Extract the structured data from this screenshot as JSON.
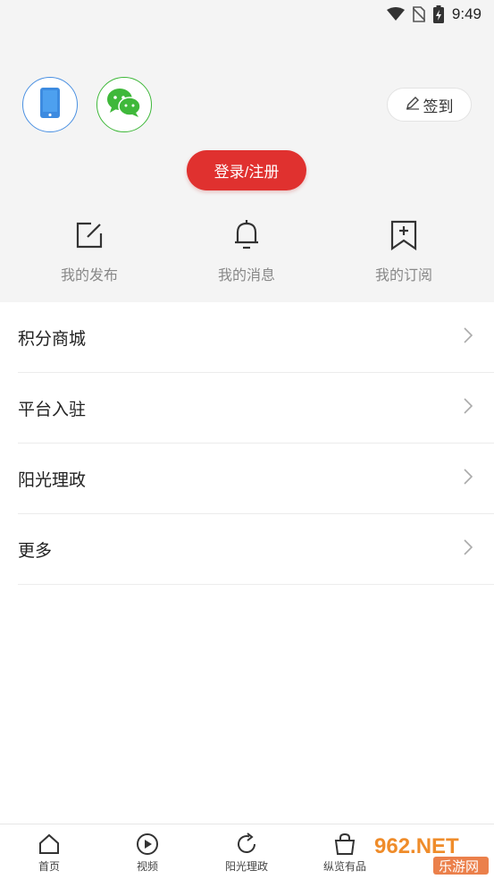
{
  "status_bar": {
    "time": "9:49",
    "icons": [
      "wifi-icon",
      "no-sim-icon",
      "battery-charging-icon"
    ]
  },
  "header": {
    "login_options": [
      {
        "name": "phone-login",
        "icon": "phone-icon",
        "color": "#4a90e2"
      },
      {
        "name": "wechat-login",
        "icon": "wechat-icon",
        "color": "#3fb83a"
      }
    ],
    "checkin_label": "签到",
    "login_register_label": "登录/注册",
    "accent_color": "#e0312f"
  },
  "quick_actions": [
    {
      "label": "我的发布",
      "icon": "edit-icon"
    },
    {
      "label": "我的消息",
      "icon": "bell-icon"
    },
    {
      "label": "我的订阅",
      "icon": "bookmark-add-icon"
    }
  ],
  "menu": [
    {
      "label": "积分商城"
    },
    {
      "label": "平台入驻"
    },
    {
      "label": "阳光理政"
    },
    {
      "label": "更多"
    }
  ],
  "bottom_nav": [
    {
      "label": "首页",
      "icon": "home-icon"
    },
    {
      "label": "视频",
      "icon": "play-icon"
    },
    {
      "label": "阳光理政",
      "icon": "refresh-icon"
    },
    {
      "label": "纵览有品",
      "icon": "shopping-bag-icon"
    }
  ],
  "watermark": {
    "line1": "962.NET",
    "line2": "乐游网"
  }
}
